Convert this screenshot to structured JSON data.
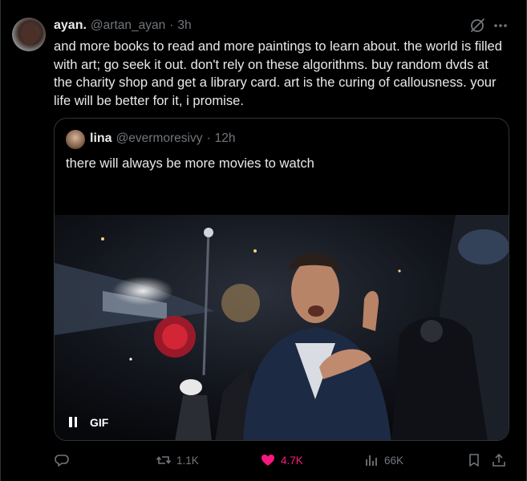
{
  "post": {
    "display_name": "ayan.",
    "handle": "@artan_ayan",
    "separator": "·",
    "time": "3h",
    "text": "and more books to read and more paintings to learn about. the world is filled with art; go seek it out. don't rely on these algorithms. buy random dvds at the charity shop and get a library card. art is the curing of callousness. your life will be better for it, i promise."
  },
  "quote": {
    "display_name": "lina",
    "handle": "@evermoresivy",
    "separator": "·",
    "time": "12h",
    "text": "there will always be more movies to watch",
    "media": {
      "badge": "GIF",
      "control_icon": "pause-icon"
    }
  },
  "actions": {
    "reply_count": "",
    "repost_count": "1.1K",
    "like_count": "4.7K",
    "views_count": "66K"
  },
  "colors": {
    "background": "#000000",
    "text": "#e7e9ea",
    "secondary": "#71767b",
    "border": "#2f3336",
    "like": "#f91880"
  },
  "icons": [
    "grok-icon",
    "more-icon",
    "reply-icon",
    "repost-icon",
    "heart-icon",
    "views-icon",
    "bookmark-icon",
    "share-icon",
    "pause-icon"
  ]
}
